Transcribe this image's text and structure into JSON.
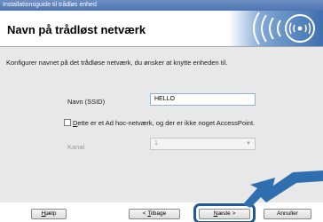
{
  "window": {
    "title": "Installationsguide til trådløs enhed"
  },
  "header": {
    "title": "Navn på trådløst netværk",
    "logo_icon": "wireless-waves-icon"
  },
  "form": {
    "instruction": "Konfigurer navnet på det trådløse netværk, du ønsker at knytte enheden til.",
    "ssid_label": "Navn (SSID)",
    "ssid_value": "HELLO",
    "adhoc_label_underlined": "D",
    "adhoc_label_rest": "ette er et Ad hoc-netværk, og der er ikke noget AccessPoint.",
    "adhoc_checked": false,
    "channel_label": "Kanal",
    "channel_value": "1"
  },
  "buttons": {
    "help_underlined": "H",
    "help_rest": "jælp",
    "back_prefix": "< ",
    "back_underlined": "T",
    "back_rest": "ilbage",
    "next_underlined": "N",
    "next_rest": "æste >",
    "cancel": "Annuller"
  },
  "colors": {
    "titlebar": "#5a7fb9",
    "content_bg": "#e8e8e8",
    "highlight": "#1f5a96",
    "arrow": "#2f6fb0"
  }
}
